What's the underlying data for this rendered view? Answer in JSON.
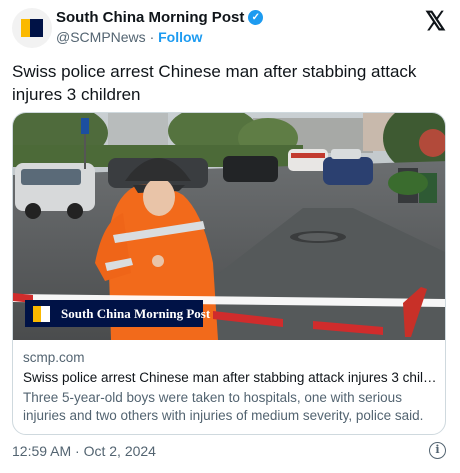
{
  "header": {
    "display_name": "South China Morning Post",
    "verified_glyph": "✓",
    "handle": "@SCMPNews",
    "separator": "·",
    "follow_label": "Follow",
    "avatar_icon": "scmp-logo-icon",
    "x_icon": "x-logo-icon",
    "x_glyph": "𝕏"
  },
  "tweet": {
    "text": "Swiss police arrest Chinese man after stabbing attack injures 3 children"
  },
  "card": {
    "image_brand": "South China Morning Post",
    "domain": "scmp.com",
    "title": "Swiss police arrest Chinese man after stabbing attack injures 3 child...",
    "description": "Three 5-year-old boys were taken to hospitals, one with serious injuries and two others with injuries of medium severity, police said."
  },
  "footer": {
    "timestamp": "12:59 AM · Oct 2, 2024",
    "info_glyph": "i",
    "info_icon": "info-icon"
  },
  "colors": {
    "accent": "#1d9bf0",
    "text": "#0f1419",
    "secondary_text": "#536471",
    "border": "#cfd9de",
    "scmp_yellow": "#fbb900",
    "scmp_navy": "#001246"
  }
}
